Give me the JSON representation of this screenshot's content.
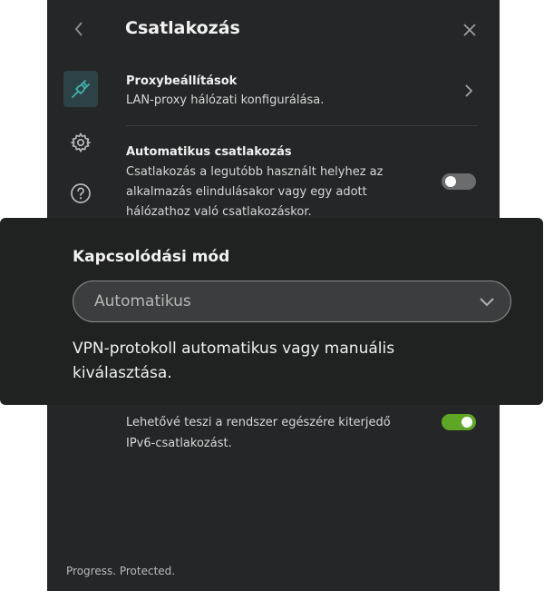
{
  "header": {
    "title": "Csatlakozás",
    "back_icon": "chevron-left-icon",
    "close_icon": "close-icon"
  },
  "sidebar": {
    "items": [
      {
        "icon": "plug-icon",
        "active": true
      },
      {
        "icon": "gear-icon",
        "active": false
      },
      {
        "icon": "help-icon",
        "active": false
      }
    ]
  },
  "settings": {
    "proxy": {
      "title": "Proxybeállítások",
      "description": "LAN-proxy hálózati konfigurálása."
    },
    "auto_connect": {
      "title": "Automatikus csatlakozás",
      "description_lines": [
        "Csatlakozás a legutóbb használt helyhez az",
        "alkalmazás elindulásakor vagy egy adott",
        "hálózathoz való csatlakozáskor."
      ],
      "enabled": false
    },
    "ipv6": {
      "description_lines": [
        "Lehetővé teszi a rendszer egészére kiterjedő",
        "IPv6-csatlakozást."
      ],
      "enabled": true
    }
  },
  "overlay": {
    "label": "Kapcsolódási mód",
    "select_value": "Automatikus",
    "description_lines": [
      "VPN-protokoll automatikus vagy manuális",
      "kiválasztása."
    ]
  },
  "footer": {
    "text": "Progress. Protected."
  },
  "colors": {
    "panel_bg": "#252627",
    "overlay_bg": "#202121",
    "active_nav_bg": "#2d4246",
    "accent_teal": "#3fb3b0",
    "toggle_on": "#5fa626",
    "toggle_off": "#6a6c6e"
  }
}
